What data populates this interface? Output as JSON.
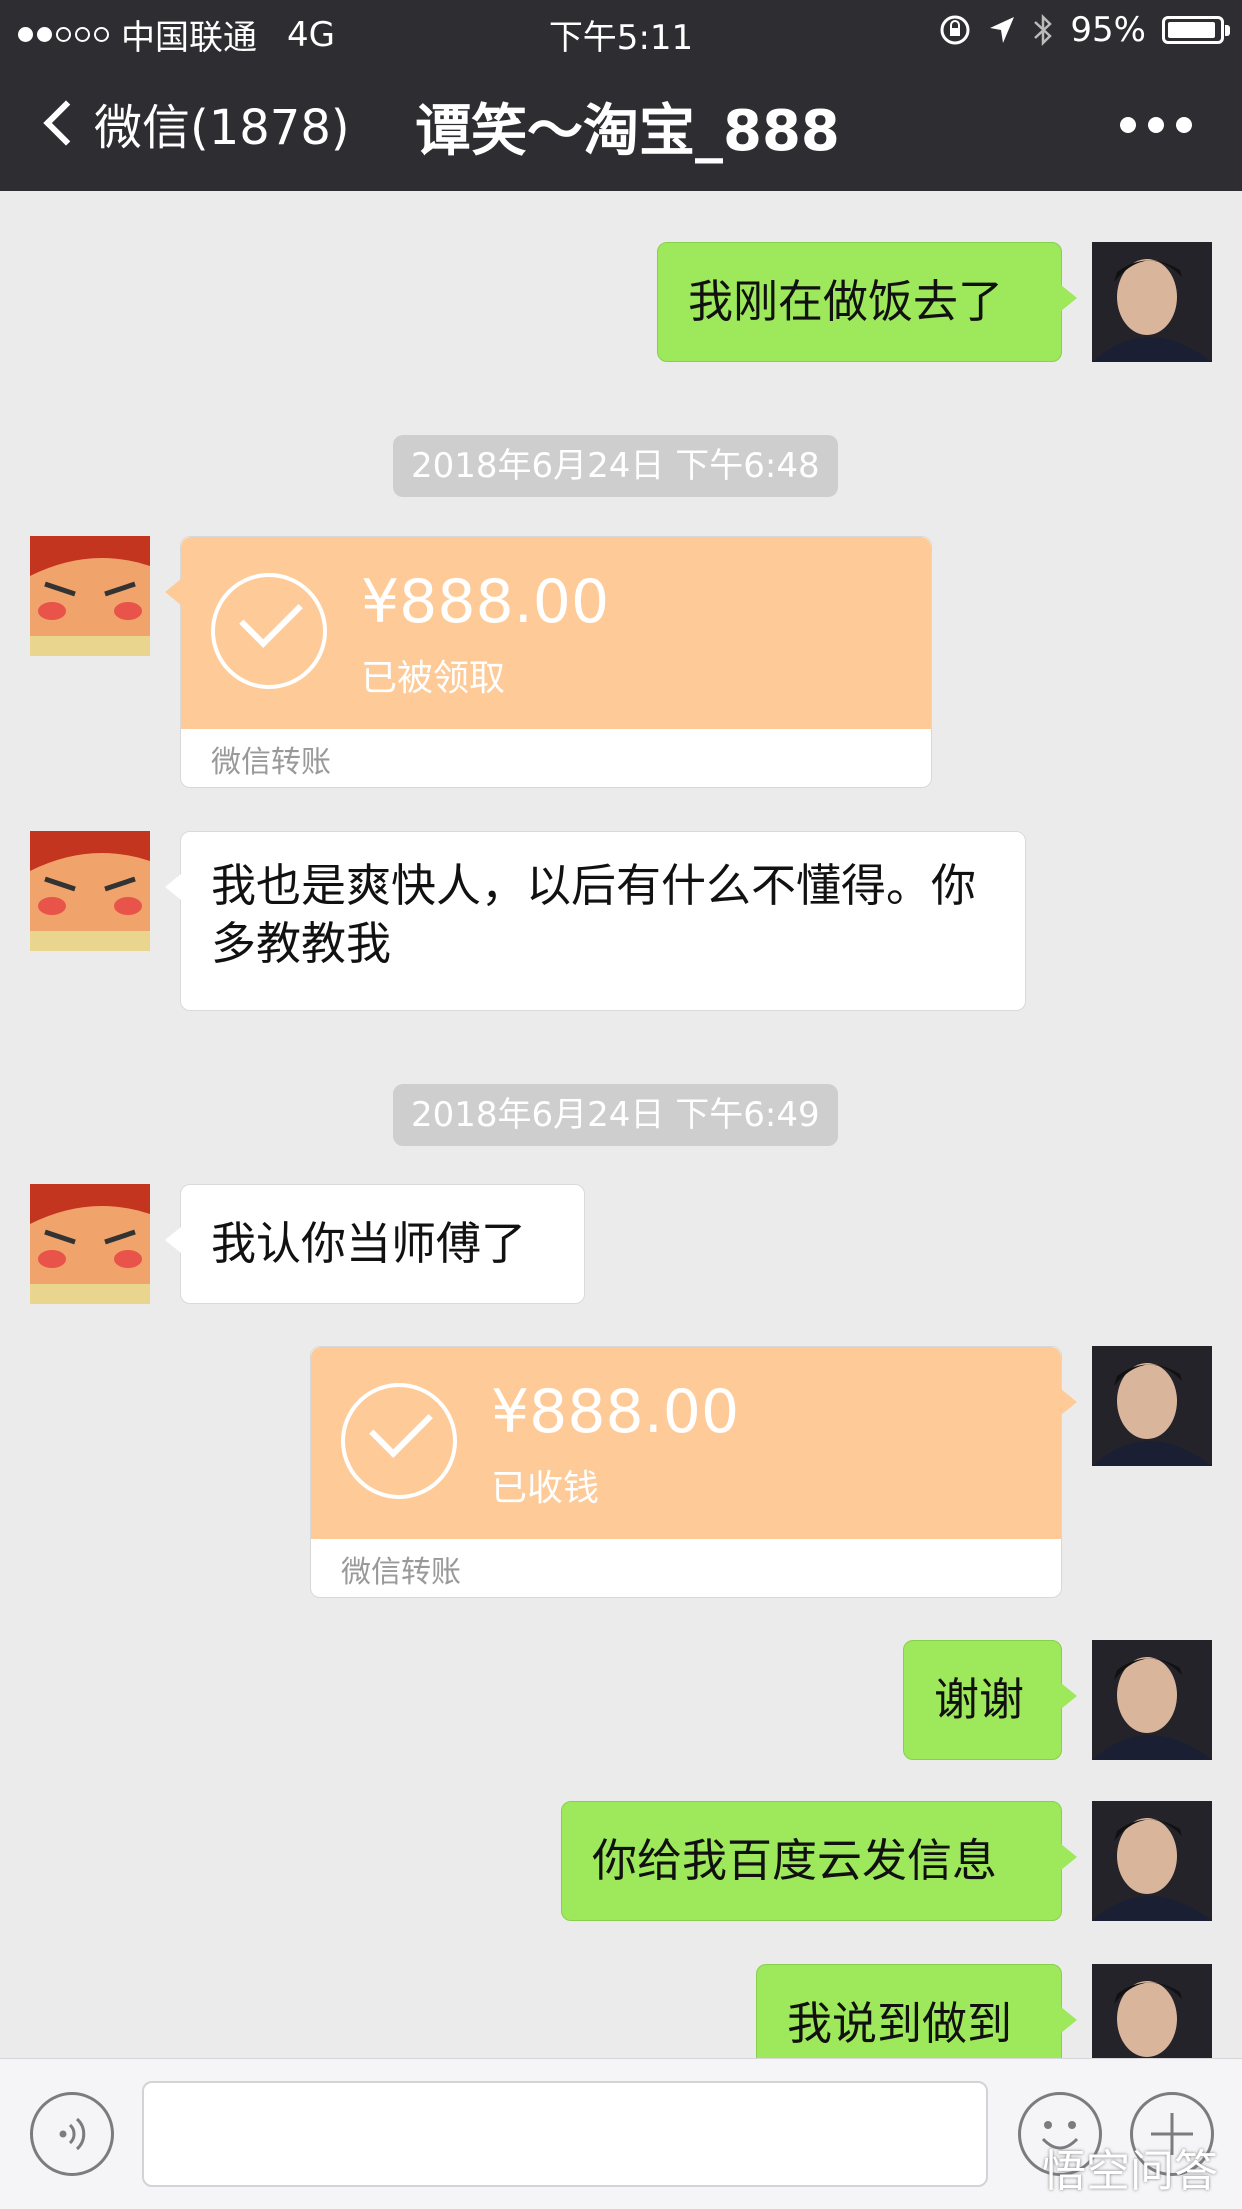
{
  "status_bar": {
    "carrier": "中国联通",
    "network": "4G",
    "time": "下午5:11",
    "battery_percent": "95%",
    "battery_level": 0.95,
    "signal_bars": 2
  },
  "nav": {
    "back_label": "微信(1878)",
    "title": "谭笑～淘宝_888"
  },
  "messages": {
    "m1": {
      "text": "我刚在做饭去了",
      "side": "right"
    },
    "time1": "2018年6月24日 下午6:48",
    "transfer1": {
      "amount": "¥888.00",
      "status": "已被领取",
      "footer": "微信转账",
      "side": "left"
    },
    "m2": {
      "text": "我也是爽快人，以后有什么不懂得。你多教教我",
      "side": "left"
    },
    "time2": "2018年6月24日 下午6:49",
    "m3": {
      "text": "我认你当师傅了",
      "side": "left"
    },
    "transfer2": {
      "amount": "¥888.00",
      "status": "已收钱",
      "footer": "微信转账",
      "side": "right"
    },
    "m4": {
      "text": "谢谢",
      "side": "right"
    },
    "m5": {
      "text": "你给我百度云发信息",
      "side": "right"
    },
    "m6": {
      "text": "我说到做到",
      "side": "right"
    }
  },
  "input_bar": {
    "placeholder": ""
  },
  "watermark": "悟空问答",
  "colors": {
    "header_bg": "#2e2d32",
    "chat_bg": "#ebebeb",
    "green_bubble": "#9ee85b",
    "transfer_orange": "#fecb98"
  }
}
